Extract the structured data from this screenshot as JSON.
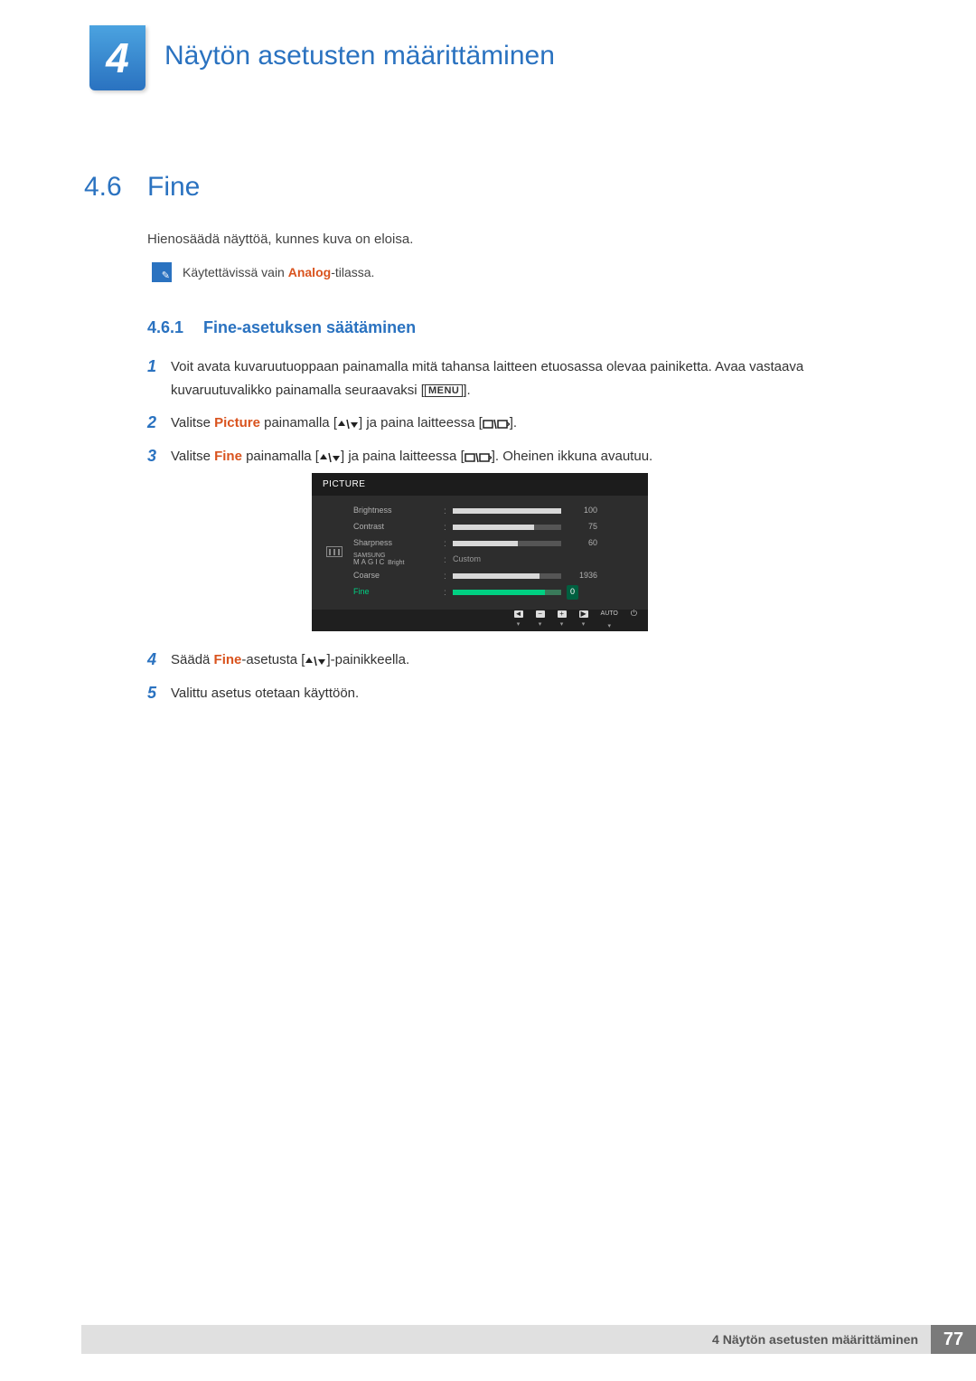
{
  "chapter": {
    "number": "4",
    "title": "Näytön asetusten määrittäminen"
  },
  "section": {
    "number": "4.6",
    "title": "Fine",
    "intro": "Hienosäädä näyttöä, kunnes kuva on eloisa.",
    "note_prefix": "Käytettävissä vain ",
    "note_keyword": "Analog",
    "note_suffix": "-tilassa."
  },
  "subsection": {
    "number": "4.6.1",
    "title": "Fine-asetuksen säätäminen"
  },
  "steps": {
    "s1": "Voit avata kuvaruutuoppaan painamalla mitä tahansa laitteen etuosassa olevaa painiketta. Avaa vastaava kuvaruutuvalikko painamalla seuraavaksi [",
    "s1b": "].",
    "menu": "MENU",
    "s2a": "Valitse ",
    "s2kw": "Picture",
    "s2b": " painamalla [",
    "s2c": "] ja paina laitteessa [",
    "s2d": "].",
    "s3a": "Valitse ",
    "s3kw": "Fine",
    "s3b": " painamalla [",
    "s3c": "] ja paina laitteessa [",
    "s3d": "]. Oheinen ikkuna avautuu.",
    "s4a": "Säädä ",
    "s4kw": "Fine",
    "s4b": "-asetusta [",
    "s4c": "]-painikkeella.",
    "s5": "Valittu asetus otetaan käyttöön."
  },
  "osd": {
    "title": "PICTURE",
    "rows": [
      {
        "label": "Brightness",
        "value": "100",
        "fill": 100
      },
      {
        "label": "Contrast",
        "value": "75",
        "fill": 75
      },
      {
        "label": "Sharpness",
        "value": "60",
        "fill": 60
      },
      {
        "label_top": "SAMSUNG",
        "label_bottom": "MAGIC",
        "label_suffix": " Bright",
        "custom": "Custom"
      },
      {
        "label": "Coarse",
        "value": "1936",
        "fill": 80
      },
      {
        "label": "Fine",
        "value": "0",
        "fill": 85,
        "selected": true
      }
    ],
    "auto": "AUTO"
  },
  "footer": {
    "text": "4 Näytön asetusten määrittäminen",
    "page": "77"
  }
}
